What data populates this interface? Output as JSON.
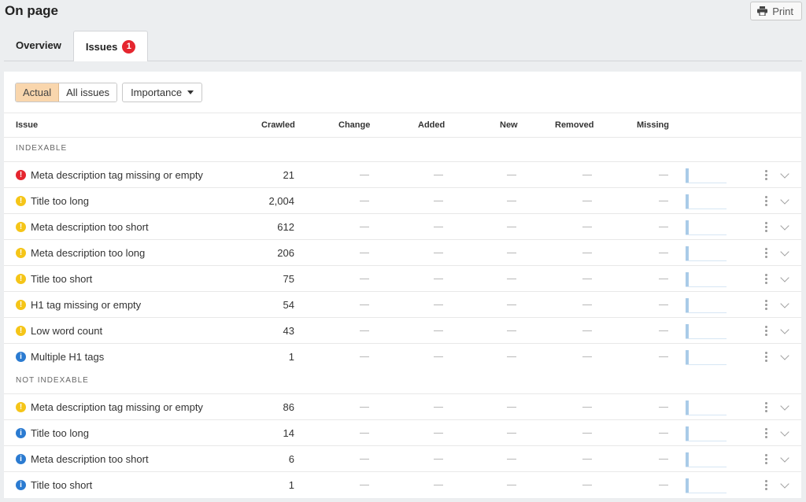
{
  "header": {
    "title": "On page",
    "print_label": "Print"
  },
  "tabs": [
    {
      "label": "Overview",
      "active": false
    },
    {
      "label": "Issues",
      "active": true,
      "badge": "1"
    }
  ],
  "filters": {
    "actual": "Actual",
    "all_issues": "All issues",
    "importance": "Importance"
  },
  "columns": [
    "Issue",
    "Crawled",
    "Change",
    "Added",
    "New",
    "Removed",
    "Missing"
  ],
  "empty_value": "—",
  "groups": [
    {
      "label": "INDEXABLE",
      "rows": [
        {
          "name": "Meta description tag missing or empty",
          "crawled": "21",
          "severity": "error"
        },
        {
          "name": "Title too long",
          "crawled": "2,004",
          "severity": "warning"
        },
        {
          "name": "Meta description too short",
          "crawled": "612",
          "severity": "warning"
        },
        {
          "name": "Meta description too long",
          "crawled": "206",
          "severity": "warning"
        },
        {
          "name": "Title too short",
          "crawled": "75",
          "severity": "warning"
        },
        {
          "name": "H1 tag missing or empty",
          "crawled": "54",
          "severity": "warning"
        },
        {
          "name": "Low word count",
          "crawled": "43",
          "severity": "warning"
        },
        {
          "name": "Multiple H1 tags",
          "crawled": "1",
          "severity": "notice"
        }
      ]
    },
    {
      "label": "NOT INDEXABLE",
      "rows": [
        {
          "name": "Meta description tag missing or empty",
          "crawled": "86",
          "severity": "warning"
        },
        {
          "name": "Title too long",
          "crawled": "14",
          "severity": "notice"
        },
        {
          "name": "Meta description too short",
          "crawled": "6",
          "severity": "notice"
        },
        {
          "name": "Title too short",
          "crawled": "1",
          "severity": "notice"
        }
      ]
    }
  ]
}
